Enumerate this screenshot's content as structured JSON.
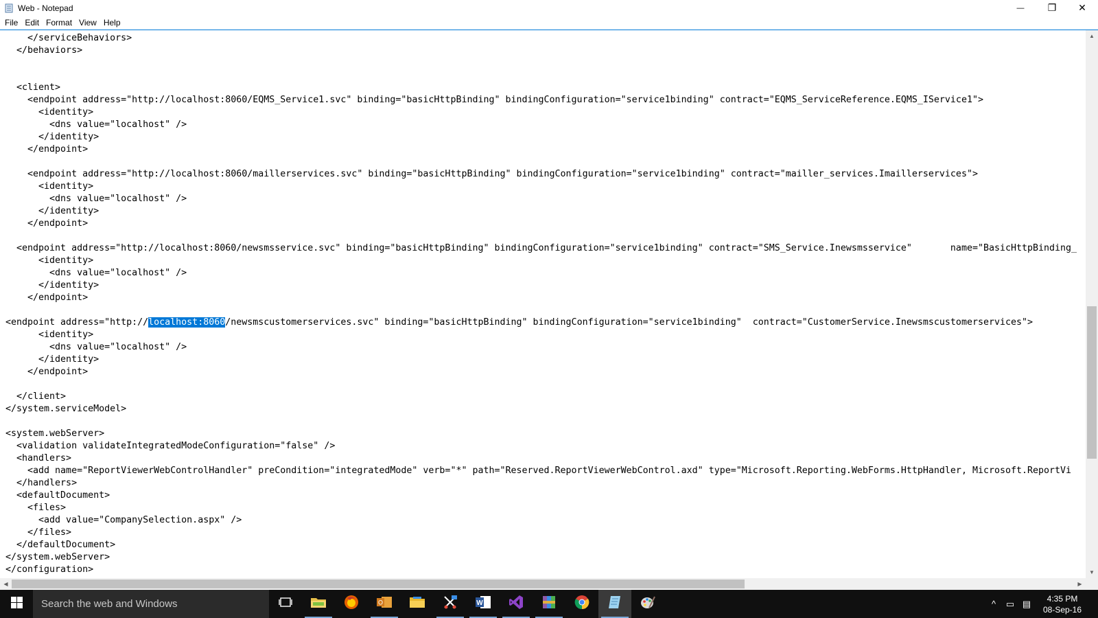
{
  "window": {
    "title": "Web - Notepad",
    "minimize_glyph": "—",
    "maximize_glyph": "❐",
    "close_glyph": "✕"
  },
  "menu": {
    "items": [
      "File",
      "Edit",
      "Format",
      "View",
      "Help"
    ]
  },
  "editor": {
    "selected_text": "localhost:8060",
    "lines": [
      "    </serviceBehaviors>",
      "  </behaviors>",
      "",
      "",
      "  <client>",
      "    <endpoint address=\"http://localhost:8060/EQMS_Service1.svc\" binding=\"basicHttpBinding\" bindingConfiguration=\"service1binding\" contract=\"EQMS_ServiceReference.EQMS_IService1\">",
      "      <identity>",
      "        <dns value=\"localhost\" />",
      "      </identity>",
      "    </endpoint>",
      "",
      "    <endpoint address=\"http://localhost:8060/maillerservices.svc\" binding=\"basicHttpBinding\" bindingConfiguration=\"service1binding\" contract=\"mailler_services.Imaillerservices\">",
      "      <identity>",
      "        <dns value=\"localhost\" />",
      "      </identity>",
      "    </endpoint>",
      "",
      "  <endpoint address=\"http://localhost:8060/newsmsservice.svc\" binding=\"basicHttpBinding\" bindingConfiguration=\"service1binding\" contract=\"SMS_Service.Inewsmsservice\"       name=\"BasicHttpBinding_",
      "      <identity>",
      "        <dns value=\"localhost\" />",
      "      </identity>",
      "    </endpoint>",
      "",
      "<endpoint address=\"http://",
      "      <identity>",
      "        <dns value=\"localhost\" />",
      "      </identity>",
      "    </endpoint>",
      "",
      "  </client>",
      "</system.serviceModel>",
      "",
      "<system.webServer>",
      "  <validation validateIntegratedModeConfiguration=\"false\" />",
      "  <handlers>",
      "    <add name=\"ReportViewerWebControlHandler\" preCondition=\"integratedMode\" verb=\"*\" path=\"Reserved.ReportViewerWebControl.axd\" type=\"Microsoft.Reporting.WebForms.HttpHandler, Microsoft.ReportVi",
      "  </handlers>",
      "  <defaultDocument>",
      "    <files>",
      "      <add value=\"CompanySelection.aspx\" />",
      "    </files>",
      "  </defaultDocument>",
      "</system.webServer>",
      "</configuration>"
    ],
    "selection_line_suffix": "/newsmscustomerservices.svc\" binding=\"basicHttpBinding\" bindingConfiguration=\"service1binding\"  contract=\"CustomerService.Inewsmscustomerservices\">"
  },
  "scrollbars": {
    "vertical_position_fraction": 0.71,
    "vertical_visible_fraction": 0.29,
    "horizontal_position_fraction": 0.0,
    "horizontal_visible_fraction": 0.69
  },
  "taskbar": {
    "search_placeholder": "Search the web and Windows",
    "apps": [
      {
        "name": "task-view-icon"
      },
      {
        "name": "file-explorer-folder-icon"
      },
      {
        "name": "firefox-icon"
      },
      {
        "name": "outlook-icon"
      },
      {
        "name": "file-explorer-icon"
      },
      {
        "name": "snipping-tool-icon"
      },
      {
        "name": "word-icon"
      },
      {
        "name": "visual-studio-icon"
      },
      {
        "name": "archive-icon"
      },
      {
        "name": "chrome-icon"
      },
      {
        "name": "notepad-icon"
      },
      {
        "name": "paint-icon"
      }
    ],
    "clock": {
      "time": "4:35 PM",
      "date": "08-Sep-16"
    },
    "tray": {
      "chevron": "^",
      "network": "▭",
      "message": "▤"
    }
  },
  "colors": {
    "selection": "#0078d7",
    "taskbar": "#101010",
    "search_box": "#2b2b2b",
    "menu_border": "#0078d7"
  }
}
